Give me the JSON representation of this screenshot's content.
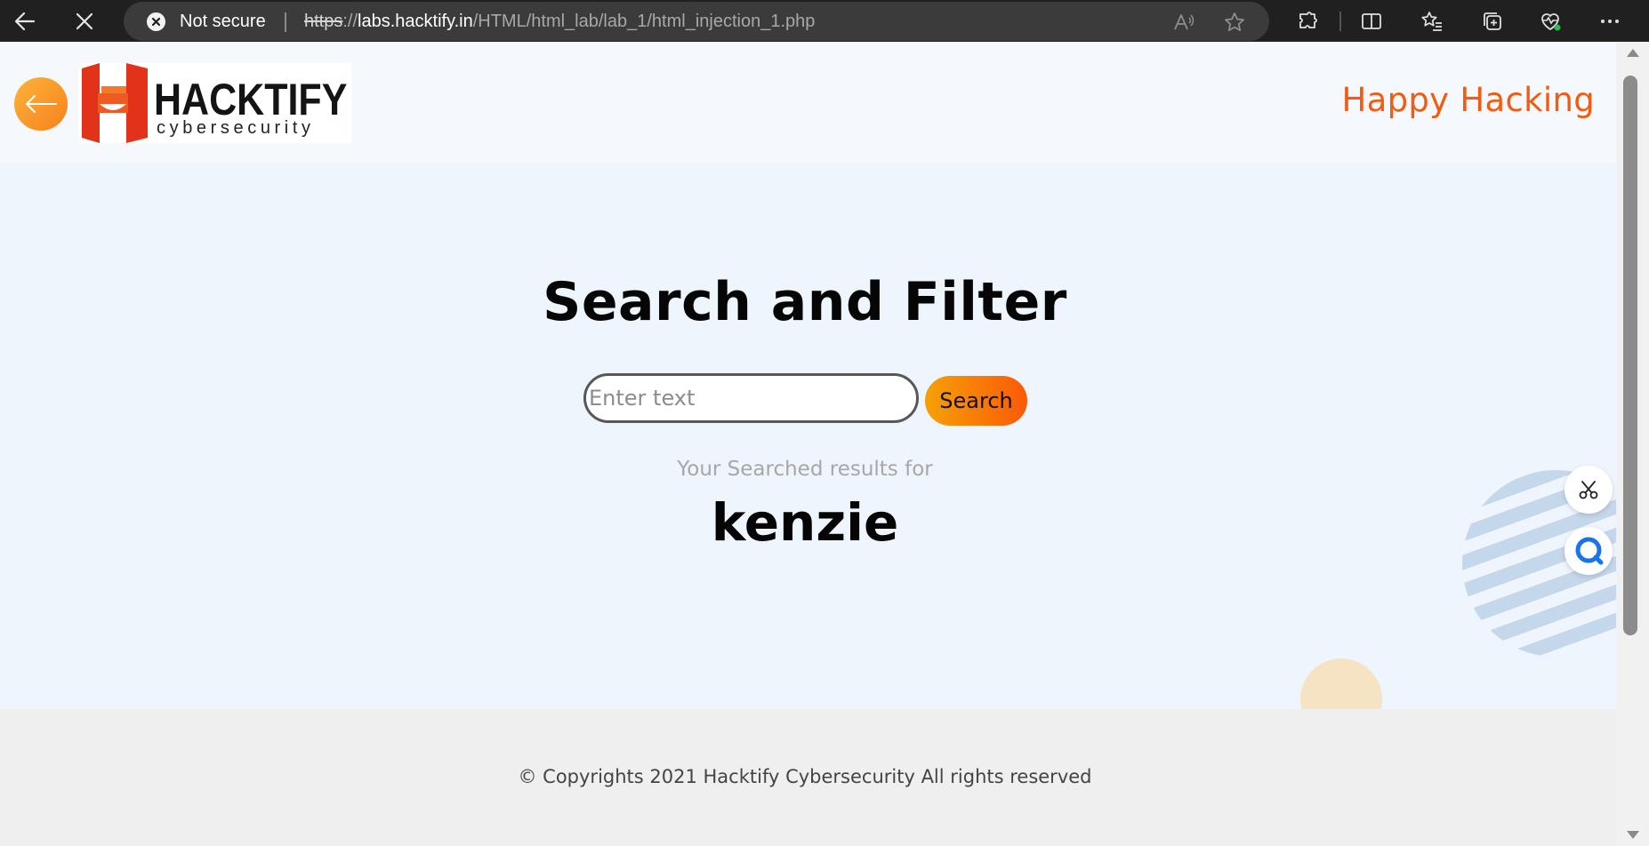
{
  "browser": {
    "security_label": "Not secure",
    "url_scheme": "https",
    "url_sep": "://",
    "url_host": "labs.hacktify.in",
    "url_path": "/HTML/html_lab/lab_1/html_injection_1.php"
  },
  "header": {
    "logo_word": "HACKTIFY",
    "logo_sub": "cybersecurity",
    "tagline": "Happy Hacking"
  },
  "main": {
    "title": "Search and Filter",
    "search_placeholder": "Enter text",
    "search_value": "",
    "search_button": "Search",
    "results_label": "Your Searched results for",
    "result_term": "kenzie"
  },
  "footer": {
    "copyright": "© Copyrights 2021 Hacktify Cybersecurity All rights reserved"
  },
  "colors": {
    "accent": "#f35b10",
    "button_gradient_start": "#f6a007",
    "button_gradient_end": "#fb5a07",
    "page_bg": "#eff5fd"
  }
}
